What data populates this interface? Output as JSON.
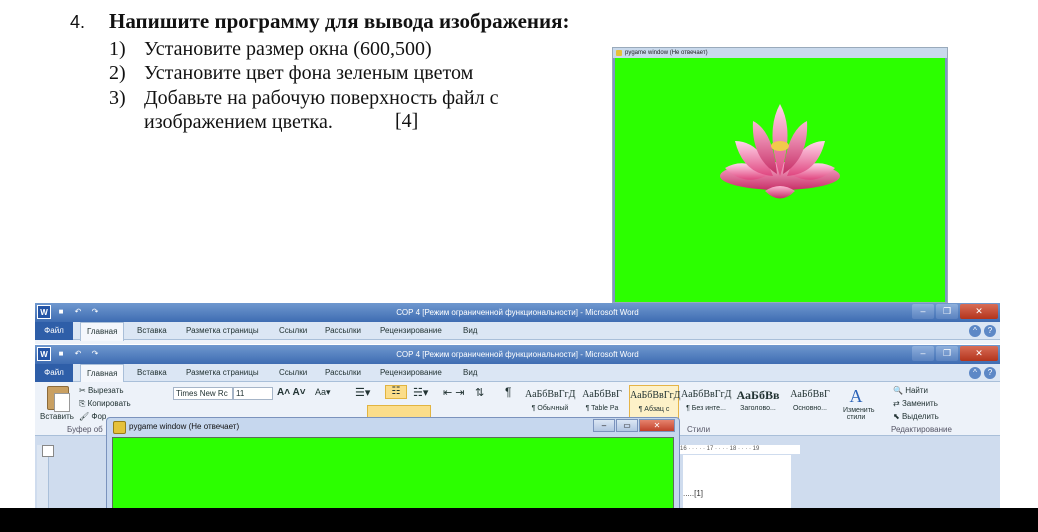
{
  "task": {
    "number": "4.",
    "title": "Напишите программу для вывода изображения:",
    "steps": [
      {
        "num": "1)",
        "text": "Установите размер окна (600,500)"
      },
      {
        "num": "2)",
        "text": "Установите цвет фона зеленым цветом"
      },
      {
        "num": "3)",
        "text": "Добавьте на рабочую поверхность файл с"
      },
      {
        "num": "",
        "text": "изображением цветка."
      }
    ],
    "score": "[4]"
  },
  "pygame_top": {
    "title": "pygame window (Не отвечает)",
    "bg_color": "#2cff00"
  },
  "word_back": {
    "caption": "СОР 4 [Режим ограниченной функциональности] - Microsoft Word",
    "file_tab": "Файл",
    "tabs": [
      "Главная",
      "Вставка",
      "Разметка страницы",
      "Ссылки",
      "Рассылки",
      "Рецензирование",
      "Вид"
    ]
  },
  "word_front": {
    "caption": "СОР 4 [Режим ограниченной функциональности] - Microsoft Word",
    "file_tab": "Файл",
    "tabs": [
      "Главная",
      "Вставка",
      "Разметка страницы",
      "Ссылки",
      "Рассылки",
      "Рецензирование",
      "Вид"
    ],
    "clipboard": {
      "paste": "Вставить",
      "cut": "Вырезать",
      "copy": "Копировать",
      "format": "Фор",
      "group": "Буфер об"
    },
    "font": {
      "name": "Times New Rc",
      "size": "11"
    },
    "styles": [
      {
        "sample": "АаБбВвГгД",
        "name": "¶ Обычный"
      },
      {
        "sample": "АаБбВвГ",
        "name": "¶ Table Pa"
      },
      {
        "sample": "АаБбВвГгД",
        "name": "¶ Абзац с"
      },
      {
        "sample": "АаБбВвГгД",
        "name": "¶ Без инте..."
      },
      {
        "sample": "АаБбВв",
        "name": "Заголово..."
      },
      {
        "sample": "АаБбВвГ",
        "name": "Основно..."
      }
    ],
    "change_styles": "Изменить стили",
    "styles_group": "Стили",
    "editing": {
      "find": "Найти",
      "replace": "Заменить",
      "select": "Выделить",
      "group": "Редактирование"
    },
    "ruler_text": "16 · · · · · 17 · · · · 18 · · · · 19",
    "doc_text": ".....[1]"
  },
  "pygame_bottom": {
    "title": "pygame window (Не отвечает)",
    "bg_color": "#2cff00"
  }
}
